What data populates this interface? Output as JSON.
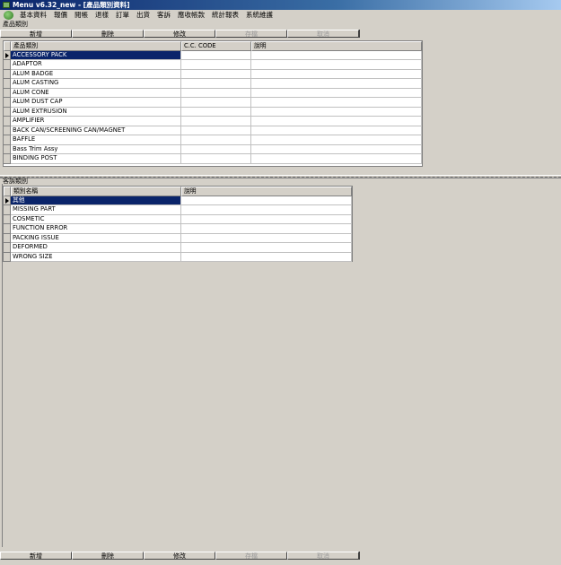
{
  "window": {
    "title": "Menu v6.32_new - [產品類別資料]"
  },
  "menu": [
    "基本資料",
    "報價",
    "閱帳",
    "退樣",
    "訂單",
    "出貨",
    "客訴",
    "應收帳款",
    "統計報表",
    "系統維護"
  ],
  "product_section": {
    "label": "產品類別",
    "toolbar": [
      "新增",
      "刪除",
      "修改",
      "存檔",
      "取消"
    ],
    "columns": [
      "產品類別",
      "C.C. CODE",
      "說明"
    ],
    "rows": [
      [
        "ACCESSORY PACK",
        "",
        ""
      ],
      [
        "ADAPTOR",
        "",
        ""
      ],
      [
        "ALUM BADGE",
        "",
        ""
      ],
      [
        "ALUM CASTING",
        "",
        ""
      ],
      [
        "ALUM CONE",
        "",
        ""
      ],
      [
        "ALUM DUST CAP",
        "",
        ""
      ],
      [
        "ALUM EXTRUSION",
        "",
        ""
      ],
      [
        "AMPLIFIER",
        "",
        ""
      ],
      [
        "BACK CAN/SCREENING CAN/MAGNET",
        "",
        ""
      ],
      [
        "BAFFLE",
        "",
        ""
      ],
      [
        "Bass Trim Assy",
        "",
        ""
      ],
      [
        "BINDING POST",
        "",
        ""
      ]
    ]
  },
  "complaint_section": {
    "label": "客訴類別",
    "columns": [
      "類別名稱",
      "說明"
    ],
    "rows": [
      [
        "其他",
        ""
      ],
      [
        "MISSING PART",
        ""
      ],
      [
        "COSMETIC",
        ""
      ],
      [
        "FUNCTION ERROR",
        ""
      ],
      [
        "PACKING ISSUE",
        ""
      ],
      [
        "DEFORMED",
        ""
      ],
      [
        "WRONG SIZE",
        ""
      ]
    ]
  },
  "bottom_toolbar": [
    "新增",
    "刪除",
    "修改",
    "存檔",
    "取消"
  ],
  "disabled_buttons": [
    "存檔",
    "取消"
  ],
  "colors": {
    "selection": "#0a246a",
    "face": "#d4d0c8"
  }
}
